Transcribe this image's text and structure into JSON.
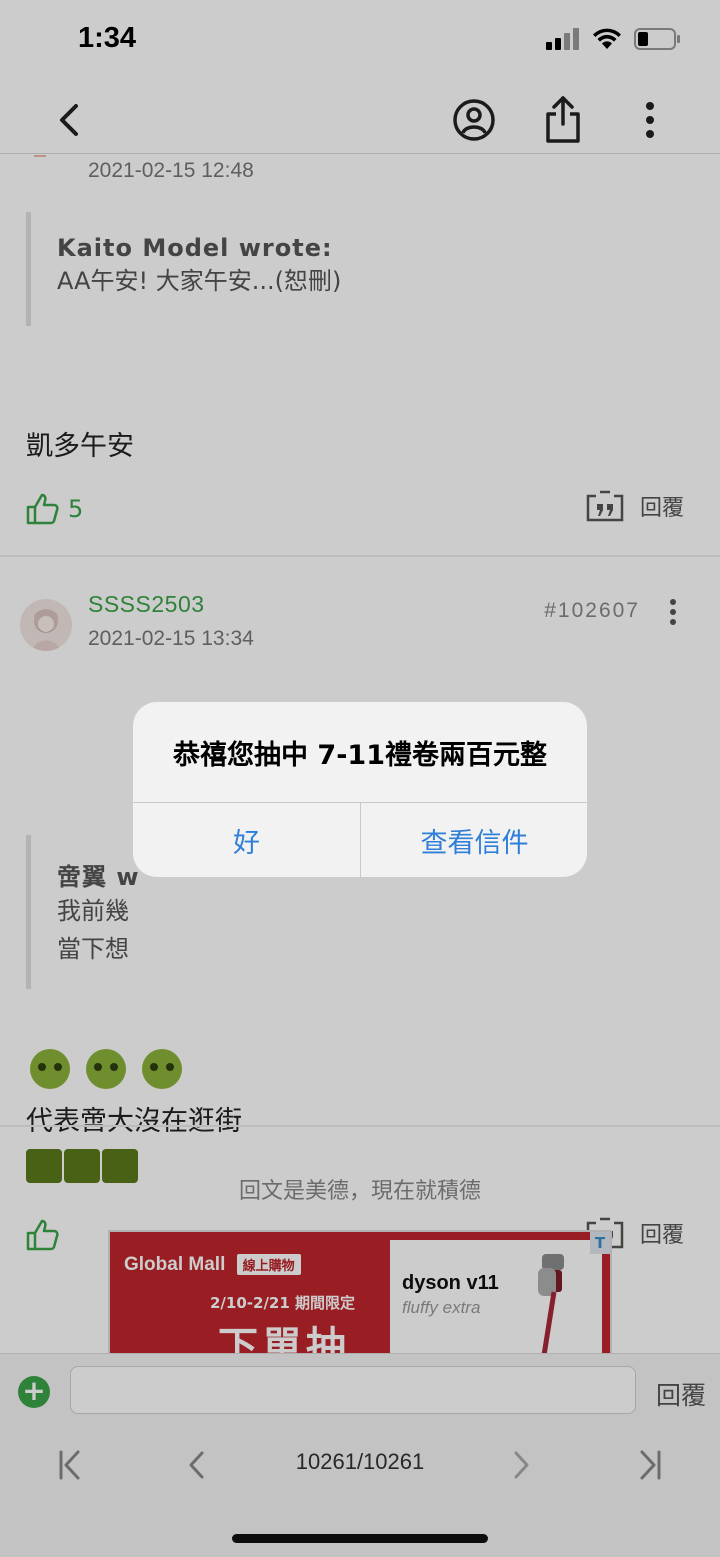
{
  "status": {
    "time": "1:34"
  },
  "posts": [
    {
      "date": "2021-02-15 12:48",
      "quote_author": "Kaito Model wrote:",
      "quote_text": "AA午安! 大家午安...(恕刪)",
      "body": "凱多午安",
      "like_count": "5",
      "reply_label": "回覆"
    },
    {
      "username": "SSSS2503",
      "date": "2021-02-15 13:34",
      "post_number": "#102607",
      "quote_author": "啻翼 w",
      "quote_line1": "我前幾",
      "quote_line2": "當下想",
      "body": "代表啻大沒在逛街",
      "reply_label": "回覆"
    }
  ],
  "footer": {
    "prompt": "回文是美德，現在就積德"
  },
  "ad": {
    "brand": "Global Mall",
    "tag": "線上購物",
    "dates": "2/10-2/21 期間限定",
    "headline": "下單抽",
    "product_brand": "dyson v11",
    "product_line": "fluffy extra",
    "badge": "T"
  },
  "reply_bar": {
    "send_label": "回覆",
    "input_value": ""
  },
  "pager": {
    "page": "10261/10261"
  },
  "alert": {
    "message": "恭禧您抽中 7-11禮卷兩百元整",
    "ok_label": "好",
    "view_label": "查看信件"
  },
  "colors": {
    "accent": "#3ba349",
    "link": "#2f7fd8"
  }
}
